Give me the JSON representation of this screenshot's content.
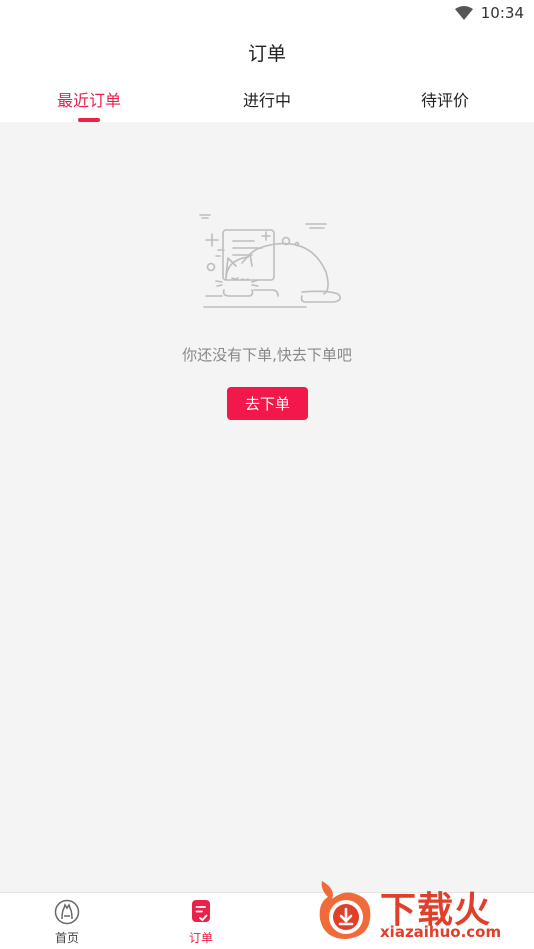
{
  "status_bar": {
    "time": "10:34",
    "wifi_icon": "wifi-icon"
  },
  "header": {
    "title": "订单"
  },
  "tabs": [
    {
      "label": "最近订单",
      "active": true
    },
    {
      "label": "进行中",
      "active": false
    },
    {
      "label": "待评价",
      "active": false
    }
  ],
  "empty_state": {
    "illustration": "sleeping-cat-document-icon",
    "message": "你还没有下单,快去下单吧",
    "button_label": "去下单"
  },
  "bottom_nav": [
    {
      "label": "首页",
      "icon": "home-cat-icon",
      "active": false
    },
    {
      "label": "订单",
      "icon": "order-list-icon",
      "active": true
    }
  ],
  "watermark": {
    "title": "下载火",
    "domain": "xiazaihuo.com"
  },
  "colors": {
    "accent": "#e8224b",
    "button": "#f2184a",
    "background": "#f4f4f4",
    "watermark": "#e0402a"
  }
}
